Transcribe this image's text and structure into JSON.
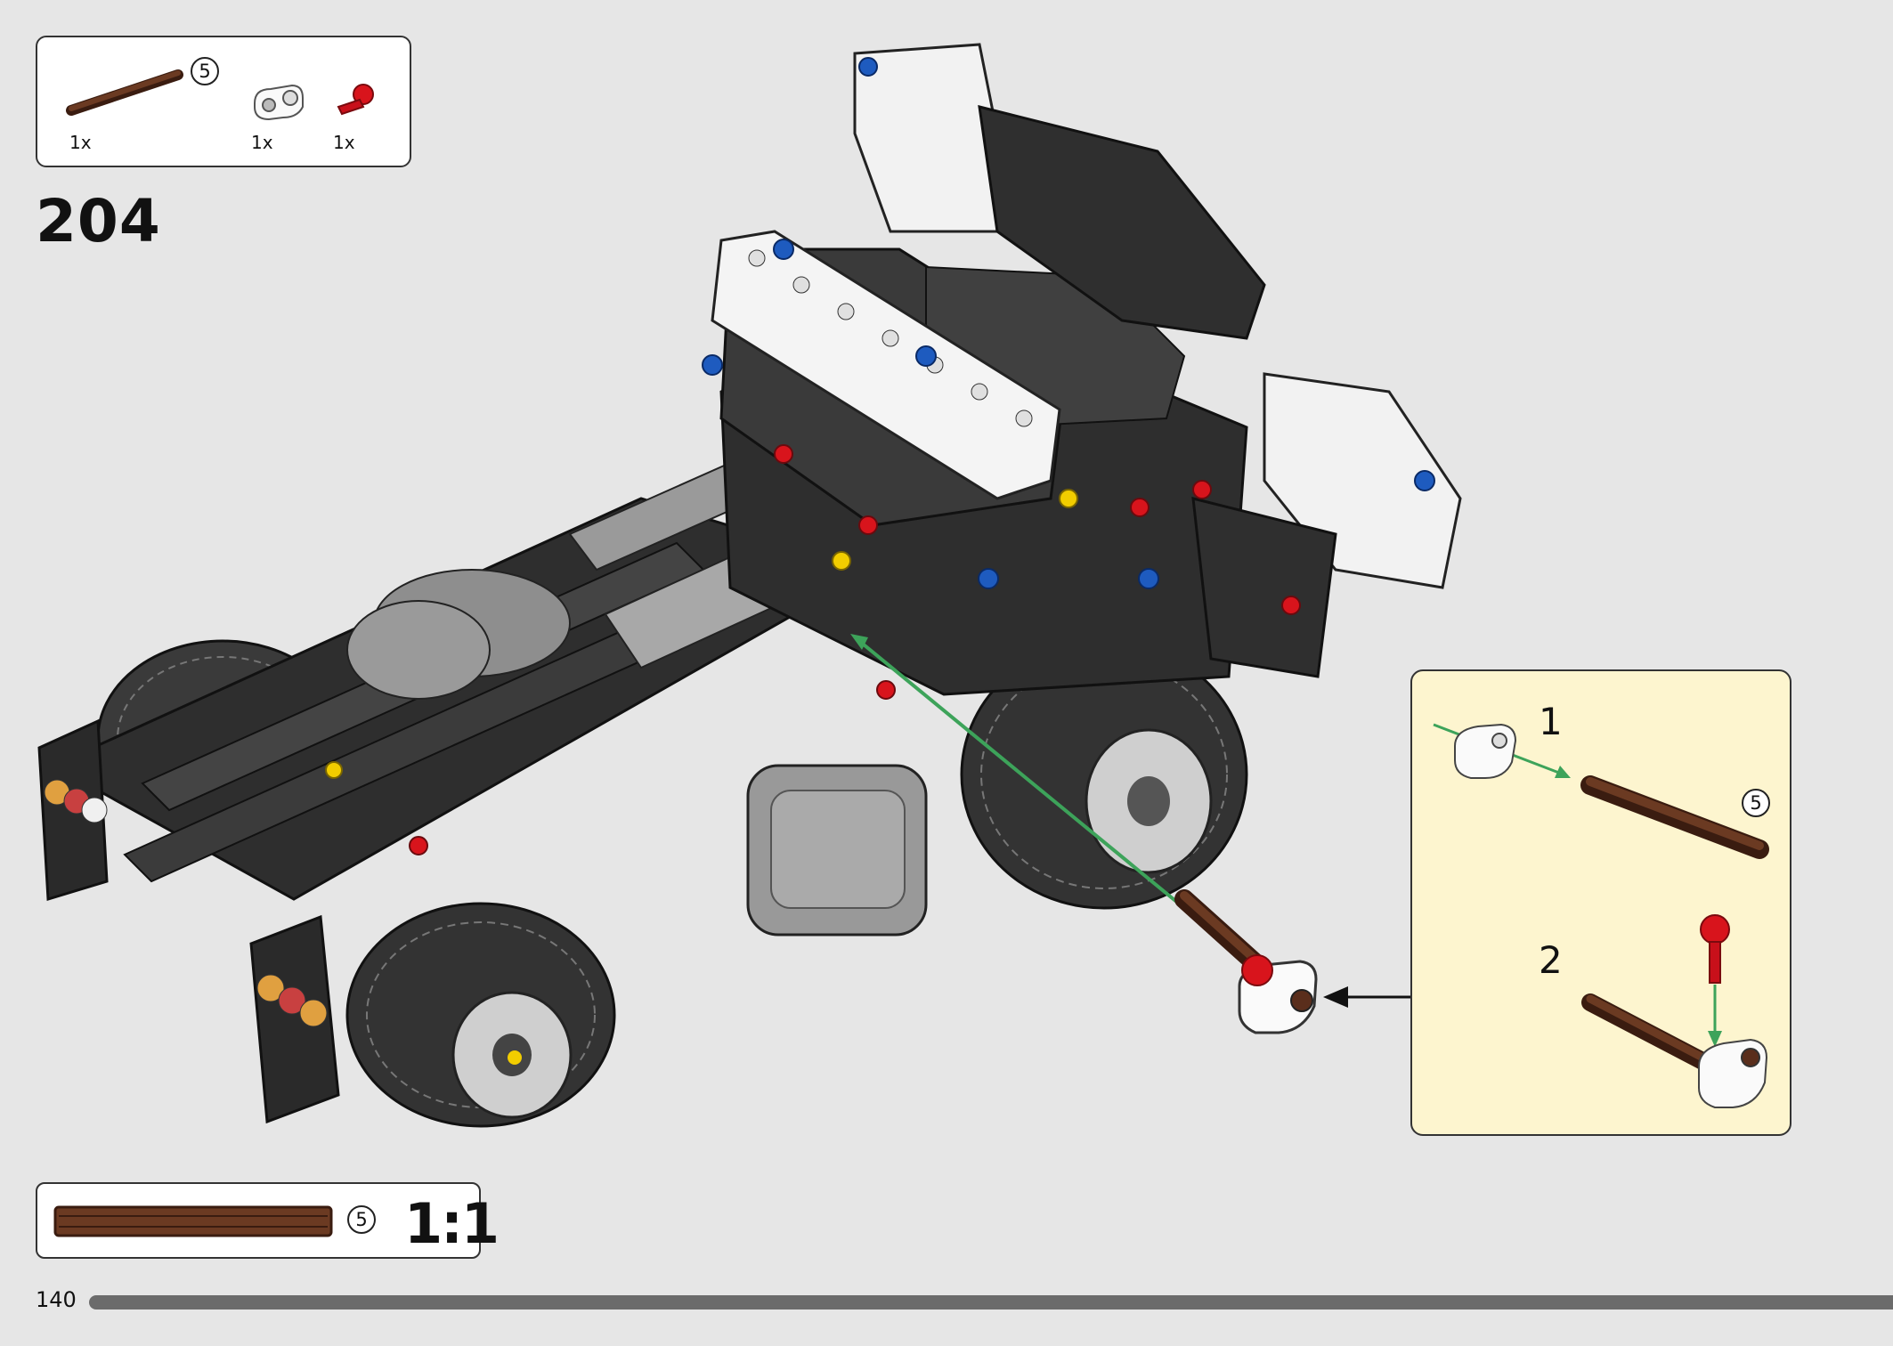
{
  "parts_list": {
    "items": [
      {
        "part": "axle",
        "color": "#5a2e1c",
        "length_label": "5",
        "quantity": "1x"
      },
      {
        "part": "pin-connector",
        "color": "#ffffff",
        "quantity": "1x"
      },
      {
        "part": "towball-pin",
        "color": "#d8141c",
        "quantity": "1x"
      }
    ]
  },
  "step": {
    "number": "204"
  },
  "callout": {
    "substeps": [
      {
        "number": "1",
        "axle_length_label": "5"
      },
      {
        "number": "2"
      }
    ]
  },
  "scale_check": {
    "length_label": "5",
    "scale": "1:1"
  },
  "footer": {
    "page_number": "140",
    "progress_fraction": 0.95
  },
  "colors": {
    "background": "#e6e6e6",
    "callout_bg": "#fdf5cf",
    "axle_brown": "#5a2e1c",
    "arrow_green": "#3da35a",
    "model_dark": "#2e2e2e",
    "brick_red": "#d8141c",
    "brick_blue": "#1e5bbf",
    "brick_yellow": "#f2cd00"
  }
}
